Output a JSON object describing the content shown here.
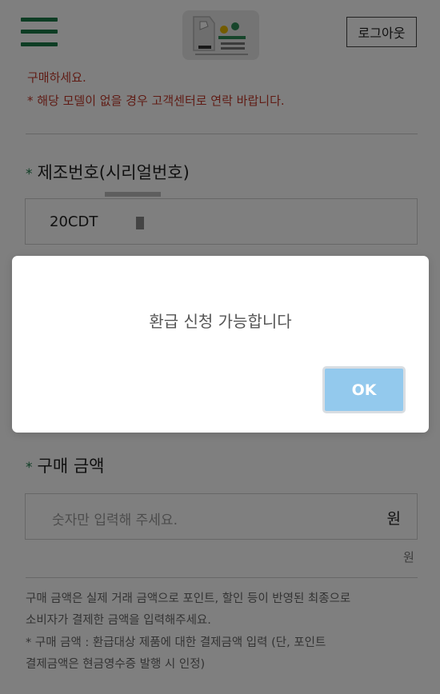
{
  "header": {
    "menu_icon": "hamburger-menu-icon",
    "logout_label": "로그아웃"
  },
  "notice": {
    "line1": "구매하세요.",
    "line2": "* 해당 모델이 없을 경우 고객센터로 연락 바랍니다."
  },
  "serial": {
    "star": "*",
    "label": "제조번호(시리얼번호)",
    "value": "20CDT"
  },
  "price": {
    "star": "*",
    "label": "구매 금액",
    "placeholder": "숫자만 입력해 주세요.",
    "unit_inside": "원",
    "unit_below": "원"
  },
  "help": {
    "line1": "구매 금액은 실제 거래 금액으로 포인트, 할인 등이 반영된 최종으로",
    "line2": "소비자가 결제한 금액을 입력해주세요.",
    "line3": "* 구매 금액 : 환급대상 제품에 대한 결제금액 입력 (단, 포인트",
    "line4": "결제금액은 현금영수증 발행 시 인정)"
  },
  "dialog": {
    "message": "환급 신청 가능합니다",
    "ok_label": "OK"
  },
  "colors": {
    "brand_green": "#1d7a48",
    "notice_red": "#c0392b",
    "ok_blue": "#93c9ed"
  }
}
